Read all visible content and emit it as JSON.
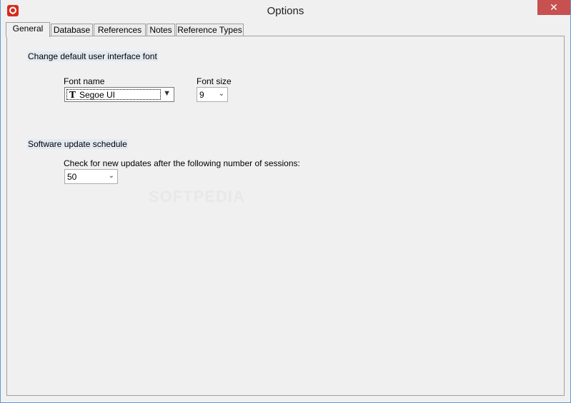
{
  "window": {
    "title": "Options",
    "close_glyph": "✕"
  },
  "tabs": [
    {
      "label": "General",
      "active": true
    },
    {
      "label": "Database",
      "active": false
    },
    {
      "label": "References",
      "active": false
    },
    {
      "label": "Notes",
      "active": false
    },
    {
      "label": "Reference Types",
      "active": false
    }
  ],
  "general": {
    "font_section_label": "Change default user interface font",
    "font_name_label": "Font name",
    "font_name_value": "Segoe UI",
    "font_size_label": "Font size",
    "font_size_value": "9",
    "update_section_label": "Software update schedule",
    "update_check_label": "Check for new updates after the following number of sessions:",
    "update_sessions_value": "50"
  },
  "watermark": "SOFTPEDIA",
  "colors": {
    "accent": "#5b9bd5",
    "close_button": "#c75050",
    "app_icon": "#d52b1e"
  }
}
